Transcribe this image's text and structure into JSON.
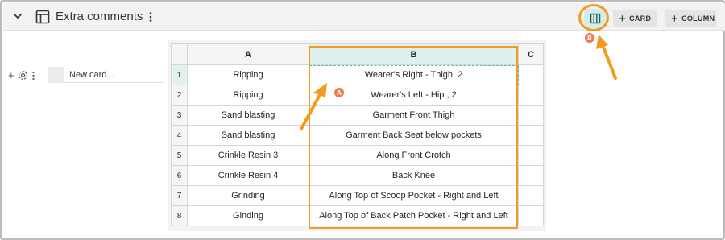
{
  "header": {
    "title": "Extra comments",
    "add_card_label": "CARD",
    "add_column_label": "COLUMN"
  },
  "new_card_placeholder": "New card...",
  "grid": {
    "columns": [
      "A",
      "B",
      "C"
    ],
    "rows": [
      {
        "num": "1",
        "a": "Ripping",
        "b": "Wearer's Right - Thigh, 2"
      },
      {
        "num": "2",
        "a": "Ripping",
        "b": "Wearer's Left - Hip , 2"
      },
      {
        "num": "3",
        "a": "Sand blasting",
        "b": "Garment Front Thigh"
      },
      {
        "num": "4",
        "a": "Sand blasting",
        "b": "Garment Back Seat below pockets"
      },
      {
        "num": "5",
        "a": "Crinkle Resin 3",
        "b": "Along Front Crotch"
      },
      {
        "num": "6",
        "a": "Crinkle Resin 4",
        "b": "Back Knee"
      },
      {
        "num": "7",
        "a": "Grinding",
        "b": "Along Top of Scoop Pocket - Right and Left"
      },
      {
        "num": "8",
        "a": "Ginding",
        "b": "Along Top of Back Patch Pocket - Right and Left"
      }
    ]
  },
  "annotations": {
    "badge_a": "A",
    "badge_b": "B"
  },
  "colors": {
    "highlight": "#f39a20",
    "badge": "#f07a4a",
    "selection": "#5fb3a8",
    "selected_header": "#dff1ef"
  },
  "icons": [
    "chevron-down-icon",
    "table-icon",
    "kebab-menu-icon",
    "column-layout-icon",
    "plus-icon",
    "gear-icon"
  ]
}
